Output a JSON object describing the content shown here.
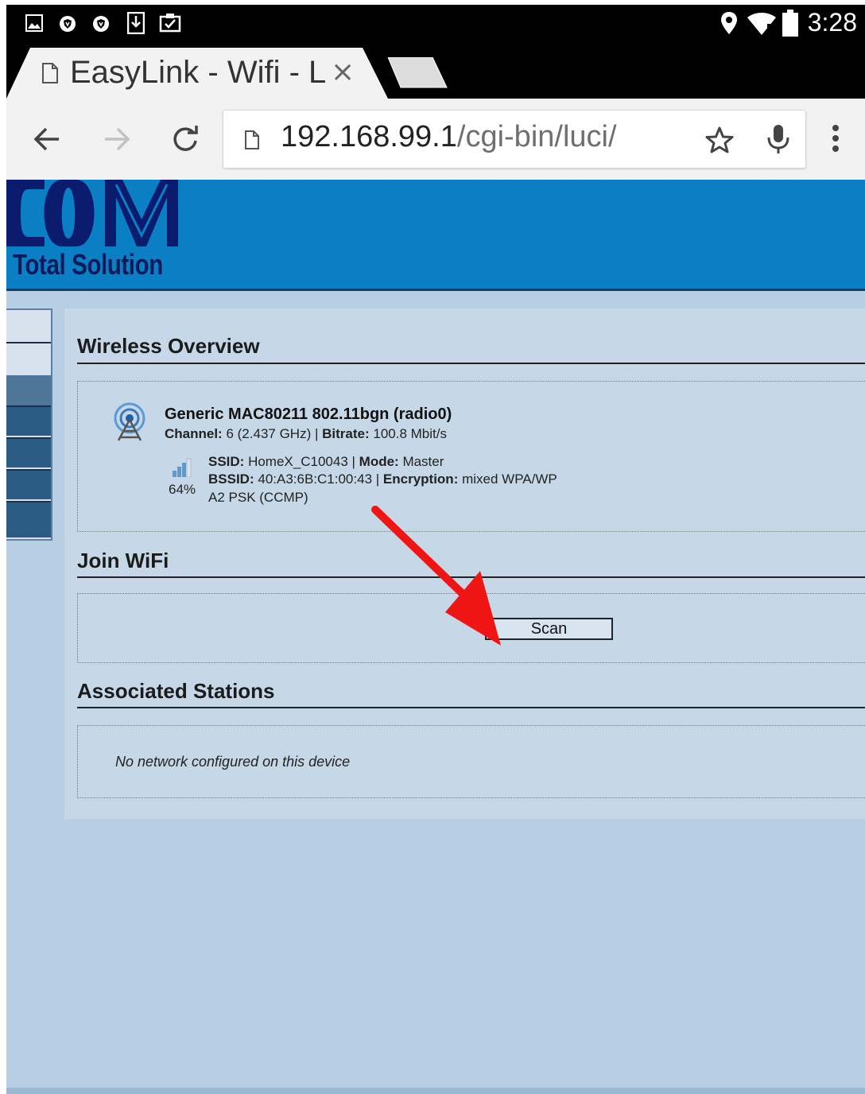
{
  "status_bar": {
    "time": "3:28",
    "left_icons": [
      "gallery-icon",
      "shield-icon",
      "shield-icon",
      "download-icon",
      "clipboard-icon"
    ],
    "right_icons": [
      "location-pin-icon",
      "wifi-icon",
      "battery-icon"
    ]
  },
  "browser": {
    "tab": {
      "title": "EasyLink - Wifi - L",
      "close_glyph": "×"
    },
    "url": {
      "host": "192.168.99.1",
      "path": "/cgi-bin/luci/"
    }
  },
  "header": {
    "logo_text": "Total Solution"
  },
  "wireless_overview": {
    "title": "Wireless Overview",
    "radio": {
      "name": "Generic MAC80211 802.11bgn (radio0)",
      "channel_label": "Channel:",
      "channel_value": "6 (2.437 GHz)",
      "bitrate_label": "Bitrate:",
      "bitrate_value": "100.8 Mbit/s"
    },
    "network": {
      "signal": "64%",
      "ssid_label": "SSID:",
      "ssid_value": "HomeX_C10043",
      "mode_label": "Mode:",
      "mode_value": "Master",
      "bssid_label": "BSSID:",
      "bssid_value": "40:A3:6B:C1:00:43",
      "encryption_label": "Encryption:",
      "encryption_value": "mixed WPA/WP",
      "encryption_cont": "A2 PSK (CCMP)"
    }
  },
  "join_wifi": {
    "title": "Join WiFi",
    "scan_label": "Scan"
  },
  "associated_stations": {
    "title": "Associated Stations",
    "empty_message": "No network configured on this device"
  },
  "colors": {
    "header_blue": "#0a7fc4",
    "page_bg": "#b8cfe3",
    "arrow_red": "#f01515"
  }
}
